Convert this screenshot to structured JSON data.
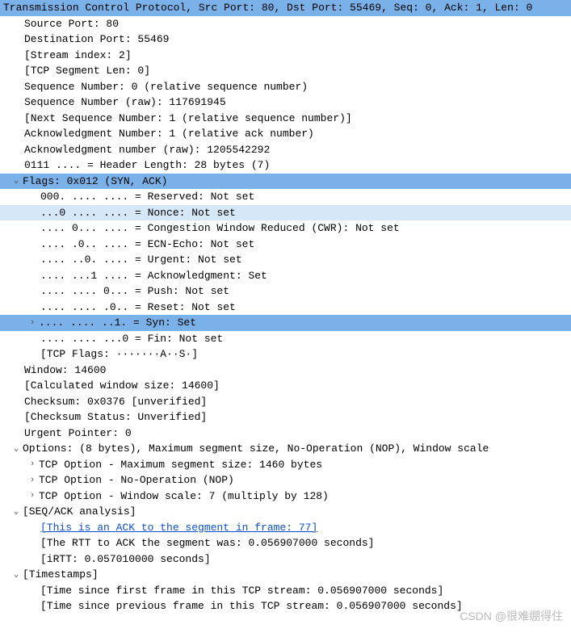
{
  "header": "Transmission Control Protocol, Src Port: 80, Dst Port: 55469, Seq: 0, Ack: 1, Len: 0",
  "fields": {
    "src_port": "Source Port: 80",
    "dst_port": "Destination Port: 55469",
    "stream_index": "[Stream index: 2]",
    "segment_len": "[TCP Segment Len: 0]",
    "seq_num": "Sequence Number: 0    (relative sequence number)",
    "seq_num_raw": "Sequence Number (raw): 117691945",
    "next_seq": "[Next Sequence Number: 1    (relative sequence number)]",
    "ack_num": "Acknowledgment Number: 1    (relative ack number)",
    "ack_num_raw": "Acknowledgment number (raw): 1205542292",
    "header_len": "0111 .... = Header Length: 28 bytes (7)"
  },
  "flags": {
    "summary": "Flags: 0x012 (SYN, ACK)",
    "reserved": "000. .... .... = Reserved: Not set",
    "nonce": "...0 .... .... = Nonce: Not set",
    "cwr": ".... 0... .... = Congestion Window Reduced (CWR): Not set",
    "ecn": ".... .0.. .... = ECN-Echo: Not set",
    "urgent": ".... ..0. .... = Urgent: Not set",
    "ack": ".... ...1 .... = Acknowledgment: Set",
    "push": ".... .... 0... = Push: Not set",
    "reset": ".... .... .0.. = Reset: Not set",
    "syn": ".... .... ..1. = Syn: Set",
    "fin": ".... .... ...0 = Fin: Not set",
    "tcp_flags": "[TCP Flags: ·······A··S·]"
  },
  "after_flags": {
    "window": "Window: 14600",
    "calc_window": "[Calculated window size: 14600]",
    "checksum": "Checksum: 0x0376 [unverified]",
    "checksum_status": "[Checksum Status: Unverified]",
    "urgent_ptr": "Urgent Pointer: 0"
  },
  "options": {
    "summary": "Options: (8 bytes), Maximum segment size, No-Operation (NOP), Window scale",
    "mss": "TCP Option - Maximum segment size: 1460 bytes",
    "nop": "TCP Option - No-Operation (NOP)",
    "wscale": "TCP Option - Window scale: 7 (multiply by 128)"
  },
  "seqack": {
    "summary": "[SEQ/ACK analysis]",
    "ack_frame": "[This is an ACK to the segment in frame: 77]",
    "rtt": "[The RTT to ACK the segment was: 0.056907000 seconds]",
    "irtt": "[iRTT: 0.057010000 seconds]"
  },
  "timestamps": {
    "summary": "[Timestamps]",
    "since_first": "[Time since first frame in this TCP stream: 0.056907000 seconds]",
    "since_prev": "[Time since previous frame in this TCP stream: 0.056907000 seconds]"
  },
  "watermark": "CSDN @很难绷得住",
  "glyphs": {
    "open": "⌄",
    "closed": "›"
  }
}
